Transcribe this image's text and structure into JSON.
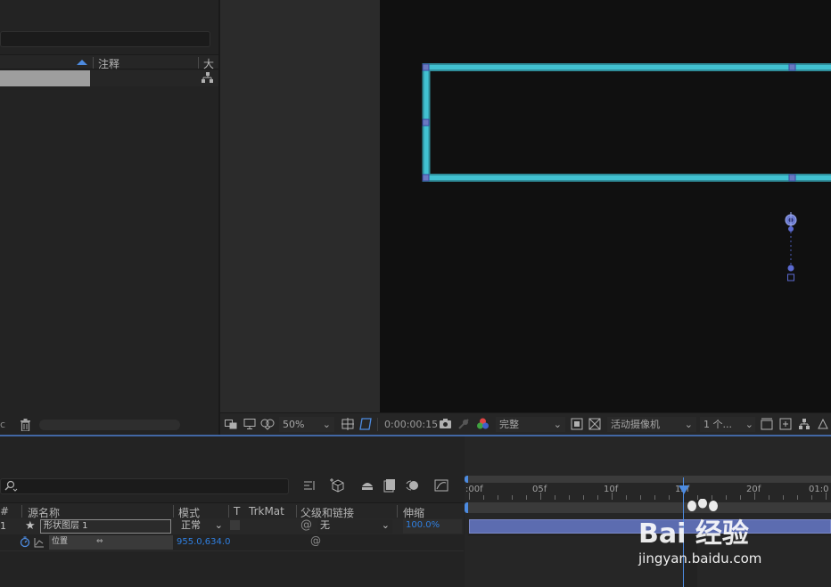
{
  "project_panel": {
    "header": {
      "sort_arrow": "sort-ascending-icon",
      "comment_col": "注释",
      "size_col": "大"
    },
    "bottom": {
      "left_char": "c"
    }
  },
  "viewer_toolbar": {
    "zoom": "50%",
    "timecode": "0:00:00:15",
    "resolution": "完整",
    "camera": "活动摄像机",
    "views": "1 个..."
  },
  "timeline": {
    "header": {
      "num": "#",
      "source_name": "源名称",
      "mode": "模式",
      "t": "T",
      "trkmat": "TrkMat",
      "parent": "父级和链接",
      "stretch": "伸缩"
    },
    "layer": {
      "index": "1",
      "name": "形状图层 1",
      "mode": "正常",
      "parent": "无",
      "stretch": "100.0%"
    },
    "property": {
      "name": "位置",
      "value": "955.0,634.0"
    },
    "ruler": {
      "labels": [
        ":00f",
        "05f",
        "10f",
        "15f",
        "20f",
        "01:0"
      ]
    }
  },
  "watermark": {
    "brand": "Bai 经验",
    "url": "jingyan.baidu.com"
  },
  "colors": {
    "accent_blue": "#4d8be0",
    "shape_stroke": "#3bb5c4",
    "layer_bar": "#5c6cb0",
    "canvas": "#101010"
  }
}
